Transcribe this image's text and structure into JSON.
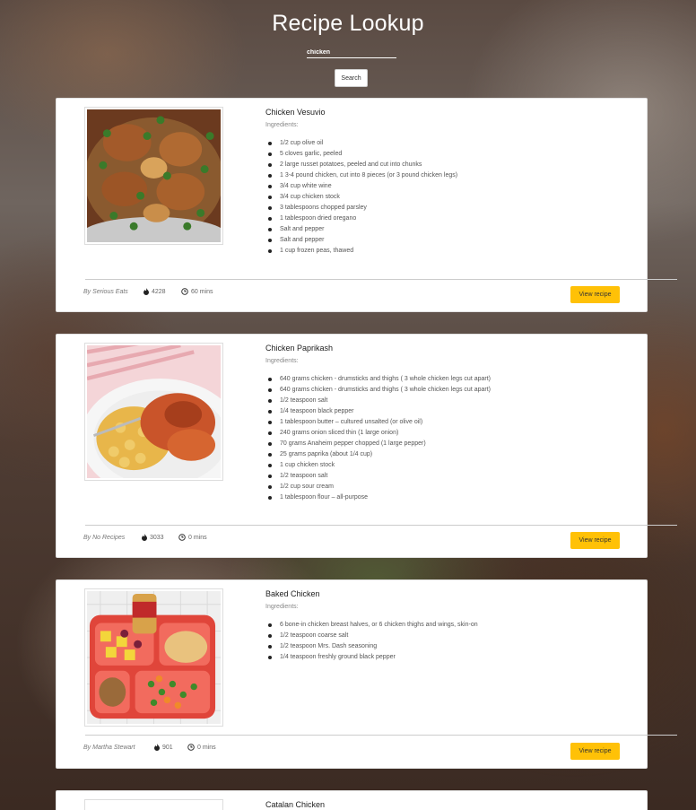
{
  "header": {
    "title": "Recipe Lookup",
    "search_value": "chicken",
    "search_button": "Search"
  },
  "labels": {
    "ingredients": "Ingredients:",
    "view_recipe": "View recipe"
  },
  "recipes": [
    {
      "title": "Chicken Vesuvio",
      "author": "By Serious Eats",
      "calories": "4228",
      "time": "60 mins",
      "ingredients": [
        "1/2 cup olive oil",
        "5 cloves garlic, peeled",
        "2 large russet potatoes, peeled and cut into chunks",
        "1 3-4 pound chicken, cut into 8 pieces (or 3 pound chicken legs)",
        "3/4 cup white wine",
        "3/4 cup chicken stock",
        "3 tablespoons chopped parsley",
        "1 tablespoon dried oregano",
        "Salt and pepper",
        "Salt and pepper",
        "1 cup frozen peas, thawed"
      ]
    },
    {
      "title": "Chicken Paprikash",
      "author": "By No Recipes",
      "calories": "3033",
      "time": "0 mins",
      "ingredients": [
        "640 grams chicken - drumsticks and thighs ( 3 whole chicken legs cut apart)",
        "640 grams chicken - drumsticks and thighs ( 3 whole chicken legs cut apart)",
        "1/2 teaspoon salt",
        "1/4 teaspoon black pepper",
        "1 tablespoon butter – cultured unsalted (or olive oil)",
        "240 grams onion sliced thin (1 large onion)",
        "70 grams Anaheim pepper chopped (1 large pepper)",
        "25 grams paprika (about 1/4 cup)",
        "1 cup chicken stock",
        "1/2 teaspoon salt",
        "1/2 cup sour cream",
        "1 tablespoon flour – all-purpose"
      ]
    },
    {
      "title": "Baked Chicken",
      "author": "By Martha Stewart",
      "calories": "901",
      "time": "0 mins",
      "ingredients": [
        "6 bone-in chicken breast halves, or 6 chicken thighs and wings, skin-on",
        "1/2 teaspoon coarse salt",
        "1/2 teaspoon Mrs. Dash seasoning",
        "1/4 teaspoon freshly ground black pepper"
      ]
    },
    {
      "title": "Catalan Chicken"
    }
  ],
  "icons": {
    "calories": "flame-icon",
    "time": "clock-icon"
  },
  "colors": {
    "accent": "#ffc107"
  }
}
